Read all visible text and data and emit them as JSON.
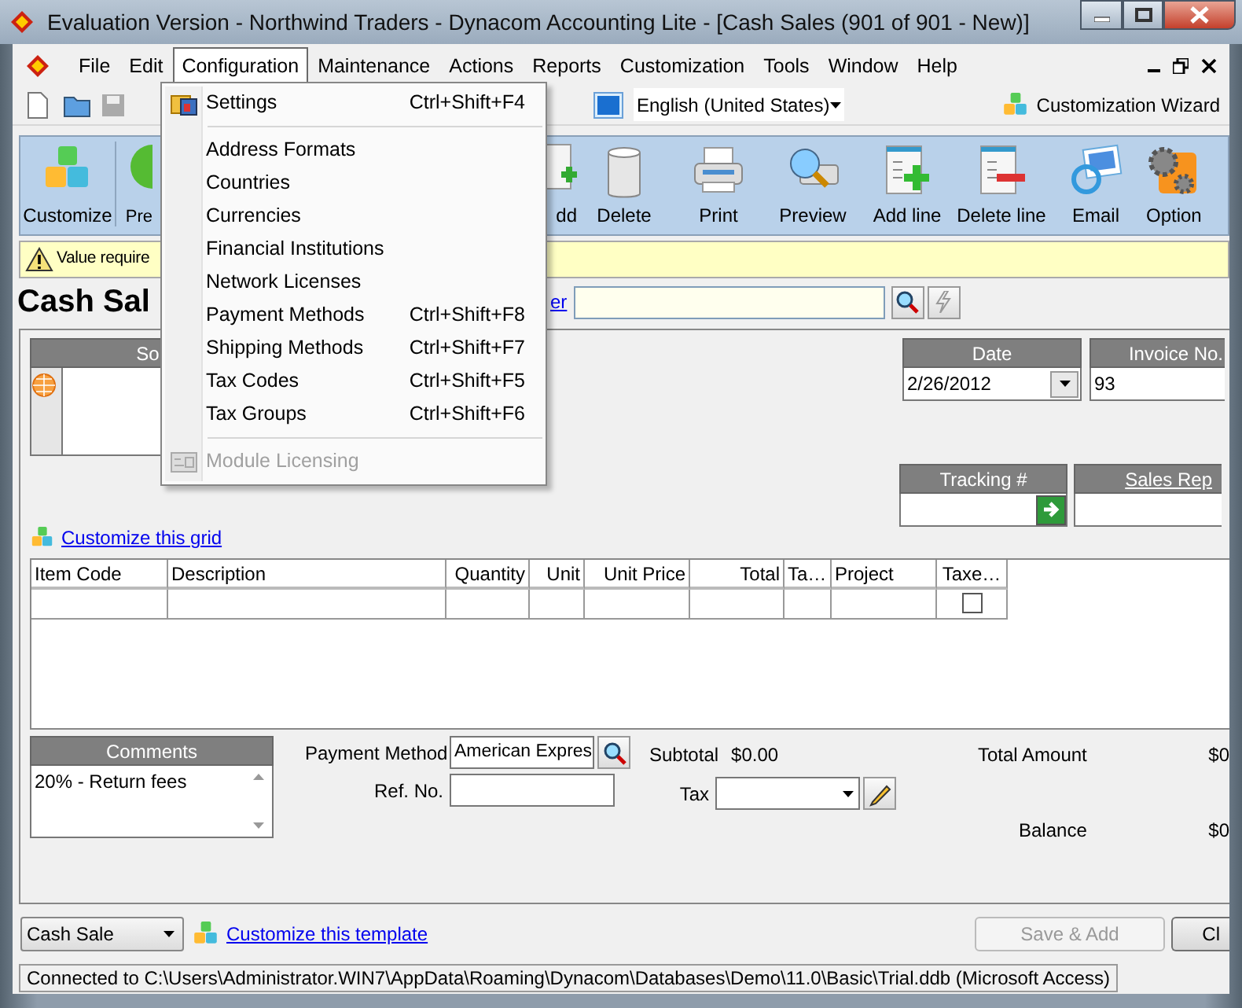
{
  "window": {
    "title": "Evaluation Version - Northwind Traders - Dynacom Accounting Lite - [Cash Sales (901 of 901 - New)]"
  },
  "menu_bar": [
    {
      "label": "File",
      "selected": false
    },
    {
      "label": "Edit",
      "selected": false
    },
    {
      "label": "Configuration",
      "selected": true
    },
    {
      "label": "Maintenance",
      "selected": false
    },
    {
      "label": "Actions",
      "selected": false
    },
    {
      "label": "Reports",
      "selected": false
    },
    {
      "label": "Customization",
      "selected": false
    },
    {
      "label": "Tools",
      "selected": false
    },
    {
      "label": "Window",
      "selected": false
    },
    {
      "label": "Help",
      "selected": false
    }
  ],
  "toolbar": {
    "language": "English (United States)",
    "wizard": "Customization Wizard"
  },
  "ribbon": [
    {
      "label": "Customize",
      "kind": "cubes"
    },
    {
      "label": "Pre",
      "kind": "ball"
    },
    {
      "label": "dd",
      "kind": "add"
    },
    {
      "label": "Delete",
      "kind": "bin"
    },
    {
      "label": "Print",
      "kind": "printer"
    },
    {
      "label": "Preview",
      "kind": "preview"
    },
    {
      "label": "Add line",
      "kind": "addline"
    },
    {
      "label": "Delete line",
      "kind": "delline"
    },
    {
      "label": "Email",
      "kind": "email"
    },
    {
      "label": "Option",
      "kind": "gears"
    }
  ],
  "warning": "Value require",
  "form": {
    "title": "Cash Sal",
    "link": "er"
  },
  "configuration_menu": [
    {
      "kind": "item",
      "label": "Settings",
      "shortcut": "Ctrl+Shift+F4",
      "disabled": false
    },
    {
      "kind": "separator"
    },
    {
      "kind": "item",
      "label": "Address Formats",
      "disabled": false
    },
    {
      "kind": "item",
      "label": "Countries",
      "disabled": false
    },
    {
      "kind": "item",
      "label": "Currencies",
      "disabled": false
    },
    {
      "kind": "item",
      "label": "Financial Institutions",
      "disabled": false
    },
    {
      "kind": "item",
      "label": "Network Licenses",
      "disabled": false
    },
    {
      "kind": "item",
      "label": "Payment Methods",
      "shortcut": "Ctrl+Shift+F8",
      "disabled": false
    },
    {
      "kind": "item",
      "label": "Shipping Methods",
      "shortcut": "Ctrl+Shift+F7",
      "disabled": false
    },
    {
      "kind": "item",
      "label": "Tax Codes",
      "shortcut": "Ctrl+Shift+F5",
      "disabled": false
    },
    {
      "kind": "item",
      "label": "Tax Groups",
      "shortcut": "Ctrl+Shift+F6",
      "disabled": false
    },
    {
      "kind": "separator"
    },
    {
      "kind": "item",
      "label": "Module Licensing",
      "disabled": true
    }
  ],
  "sold_to": {
    "label": "So"
  },
  "date": {
    "label": "Date",
    "value": "2/26/2012"
  },
  "invoice": {
    "label": "Invoice No.",
    "value": "93"
  },
  "tracking": {
    "label": "Tracking #"
  },
  "sales_rep": {
    "label": "Sales Rep"
  },
  "grid_link": "Customize this grid",
  "grid": {
    "columns": [
      {
        "label": "Item Code",
        "kind": "text"
      },
      {
        "label": "Description",
        "kind": "text"
      },
      {
        "label": "Quantity",
        "kind": "number"
      },
      {
        "label": "Unit",
        "kind": "number"
      },
      {
        "label": "Unit Price",
        "kind": "number"
      },
      {
        "label": "Total",
        "kind": "number"
      },
      {
        "label": "Ta…",
        "kind": "text"
      },
      {
        "label": "Project",
        "kind": "text"
      },
      {
        "label": "Taxe…",
        "kind": "check"
      }
    ],
    "rows": [
      {
        "checked": false
      }
    ]
  },
  "comments": {
    "label": "Comments",
    "value": "20% - Return fees"
  },
  "payment_method": {
    "label": "Payment Method",
    "value": "American Expres"
  },
  "ref_no": {
    "label": "Ref. No."
  },
  "subtotal": {
    "label": "Subtotal",
    "value": "$0.00"
  },
  "tax": {
    "label": "Tax"
  },
  "total_amount": {
    "label": "Total Amount",
    "value": "$0"
  },
  "balance": {
    "label": "Balance",
    "value": "$0"
  },
  "footer": {
    "template": "Cash Sale",
    "link": "Customize this template",
    "buttons": [
      {
        "label": "Save & Add",
        "disabled": true
      },
      {
        "label": "Cl",
        "disabled": false
      }
    ]
  },
  "status_bar": "Connected to C:\\Users\\Administrator.WIN7\\AppData\\Roaming\\Dynacom\\Databases\\Demo\\11.0\\Basic\\Trial.ddb (Microsoft Access)"
}
